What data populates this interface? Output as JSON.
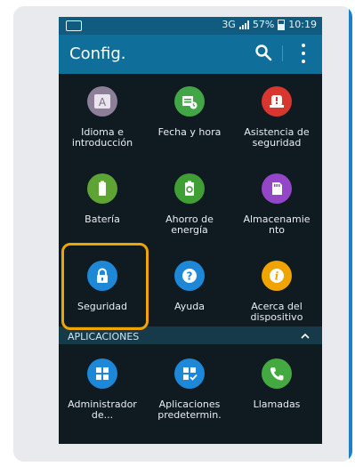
{
  "status_bar": {
    "network": "3G",
    "battery": "57%",
    "time": "10:19"
  },
  "appbar": {
    "title": "Config."
  },
  "settings": [
    {
      "label": "Idioma e\nintroducción",
      "icon": "language-icon",
      "color": "#8e7f99"
    },
    {
      "label": "Fecha y hora",
      "icon": "calendar-clock-icon",
      "color": "#42a646"
    },
    {
      "label": "Asistencia de\nseguridad",
      "icon": "safety-alert-icon",
      "color": "#d9362f"
    },
    {
      "label": "Batería",
      "icon": "battery-icon",
      "color": "#5ea435"
    },
    {
      "label": "Ahorro de\nenergía",
      "icon": "energy-saving-icon",
      "color": "#3f9f35"
    },
    {
      "label": "Almacenamie\nnto",
      "icon": "storage-icon",
      "color": "#9446c9"
    },
    {
      "label": "Seguridad",
      "icon": "lock-icon",
      "color": "#1e88d8"
    },
    {
      "label": "Ayuda",
      "icon": "help-icon",
      "color": "#1e88d8"
    },
    {
      "label": "Acerca del\ndispositivo",
      "icon": "info-icon",
      "color": "#f1a300"
    }
  ],
  "section": {
    "title": "APLICACIONES"
  },
  "apps": [
    {
      "label": "Administrador\nde...",
      "icon": "apps-grid-icon",
      "color": "#1e88d8"
    },
    {
      "label": "Aplicaciones\npredetermin.",
      "icon": "default-apps-icon",
      "color": "#1e88d8"
    },
    {
      "label": "Llamadas",
      "icon": "phone-icon",
      "color": "#45a942"
    }
  ]
}
